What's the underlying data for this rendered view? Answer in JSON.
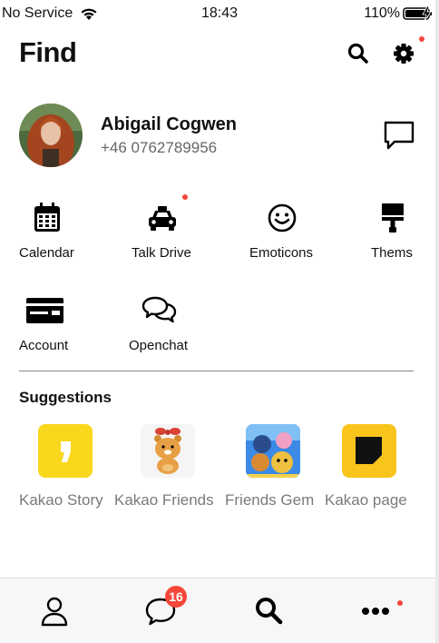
{
  "status_bar": {
    "carrier": "No Service",
    "time": "18:43",
    "battery": "110%"
  },
  "header": {
    "title": "Find"
  },
  "profile": {
    "name": "Abigail Cogwen",
    "phone": "+46 0762789956"
  },
  "menu": [
    {
      "label": "Calendar",
      "icon": "calendar-icon"
    },
    {
      "label": "Talk Drive",
      "icon": "taxi-icon"
    },
    {
      "label": "Emoticons",
      "icon": "smiley-icon"
    },
    {
      "label": "Thems",
      "icon": "paint-roller-icon"
    },
    {
      "label": "Account",
      "icon": "card-icon"
    },
    {
      "label": "Openchat",
      "icon": "chat-bubbles-icon"
    }
  ],
  "suggestions": {
    "title": "Suggestions",
    "items": [
      {
        "label": "Kakao Story",
        "color": "#f9d71c"
      },
      {
        "label": "Kakao Friends",
        "color": "#f5f5f5"
      },
      {
        "label": "Friends Gem",
        "color": "#2e73d9"
      },
      {
        "label": "Kakao page",
        "color": "#f9c51c"
      }
    ]
  },
  "tabbar": {
    "chat_badge": "16"
  },
  "colors": {
    "accent_red": "#f4473a",
    "kakao_yellow": "#f9d71c"
  }
}
